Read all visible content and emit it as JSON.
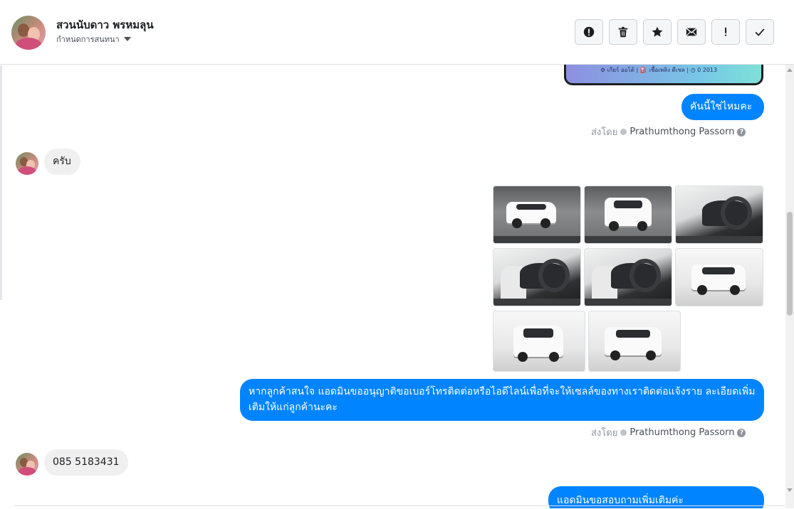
{
  "header": {
    "contact_name": "สวนนับดาว พรหมลุน",
    "assign_label": "กำหนดการสนทนา",
    "toolbar": [
      {
        "name": "spam-button",
        "icon": "alert-circle-icon"
      },
      {
        "name": "delete-button",
        "icon": "trash-icon"
      },
      {
        "name": "star-button",
        "icon": "star-icon"
      },
      {
        "name": "mark-unread-button",
        "icon": "envelope-icon"
      },
      {
        "name": "follow-up-button",
        "icon": "exclamation-icon"
      },
      {
        "name": "done-button",
        "icon": "check-icon"
      }
    ]
  },
  "messages": {
    "partial_image_spec": "⚙ เกียร์ ออโต้   |   ⛽ เชื้อเพลิง ดีเซล   |   ◷ 0 2013",
    "m1_out": "คันนี้ใช่ไหมคะ",
    "m1_sent_by_prefix": "ส่งโดย",
    "m1_sent_by_name": "Prathumthong Passorn",
    "m2_in": "ครับ",
    "m3_out": "หากลูกค้าสนใจ แอดมินขออนุญาติขอเบอร์โทรติดต่อหรือไอดีไลน์เพื่อที่จะให้เซลล์ของทางเราติดต่อแจ้งราย ละเอียดเพิ่มเติมให้แก่ลูกค้านะคะ",
    "m3_sent_by_prefix": "ส่งโดย",
    "m3_sent_by_name": "Prathumthong Passorn",
    "m4_in": "085 5183431",
    "m5_out_partial": "แอดมินขอสอบถามเพิ่มเติมค่ะ"
  },
  "colors": {
    "outgoing_bubble": "#0084ff",
    "incoming_bubble": "#f1f0f0",
    "meta_text": "#90949c"
  }
}
